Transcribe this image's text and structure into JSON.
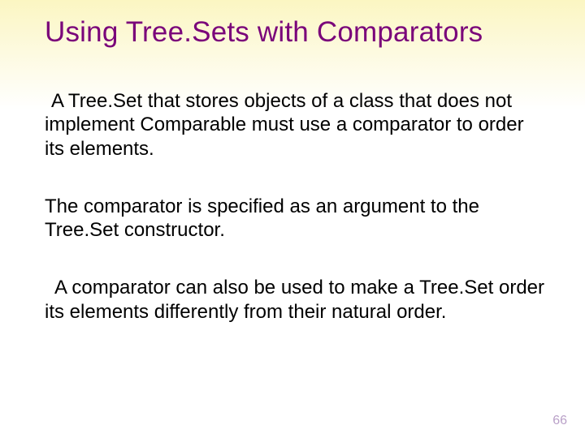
{
  "slide": {
    "title": "Using Tree.Sets with Comparators",
    "paragraphs": [
      "A Tree.Set that stores objects of a class that does not implement Comparable must use a comparator to order its elements.",
      "The comparator is specified as an argument to the Tree.Set constructor.",
      "A comparator can also be used to make a Tree.Set order its elements differently from their natural order."
    ],
    "page_number": "66"
  }
}
